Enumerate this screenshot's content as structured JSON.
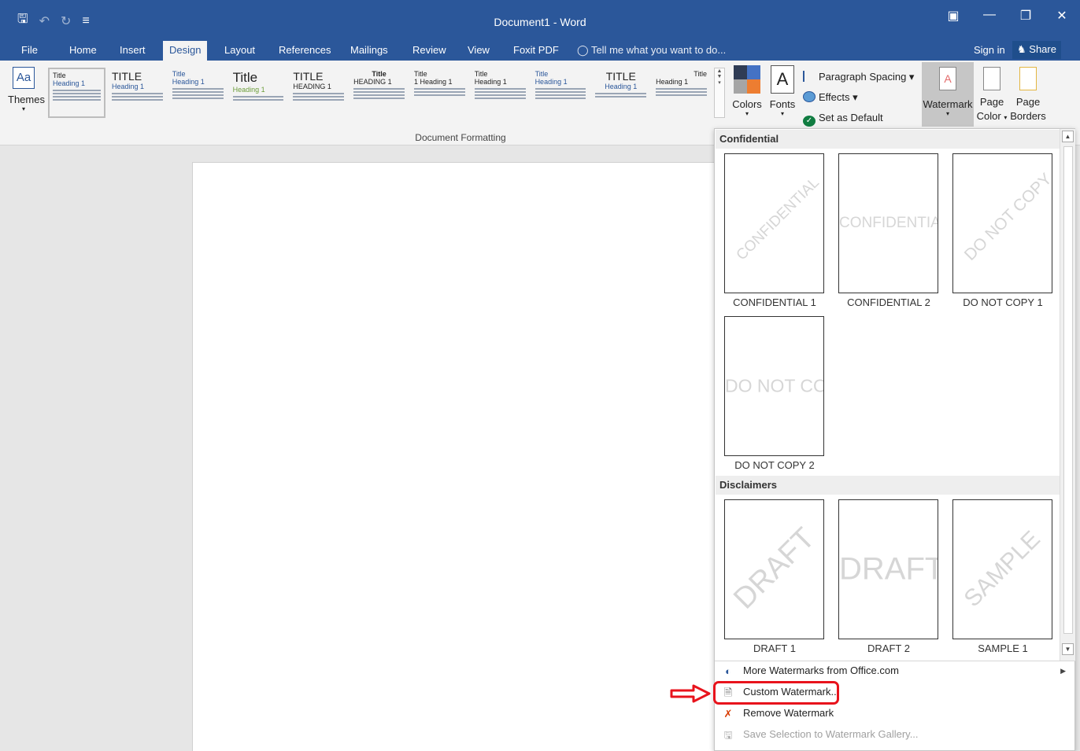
{
  "window": {
    "title": "Document1 - Word",
    "qat": {
      "save_icon": "save-icon",
      "undo_icon": "undo-icon",
      "redo_icon": "redo-icon",
      "customize_icon": "customize-qat-icon"
    },
    "controls": {
      "ribbon_options_icon": "ribbon-display-icon",
      "minimize_icon": "minimize-icon",
      "restore_icon": "restore-icon",
      "close_icon": "close-icon"
    }
  },
  "tabs": [
    "File",
    "Home",
    "Insert",
    "Design",
    "Layout",
    "References",
    "Mailings",
    "Review",
    "View",
    "Foxit PDF"
  ],
  "active_tab": "Design",
  "tell_me": "Tell me what you want to do...",
  "sign_in": "Sign in",
  "share": "Share",
  "ribbon": {
    "themes_label": "Themes",
    "themes_icon_text": "Aa",
    "style_set": [
      {
        "title": "Title",
        "heading": "Heading 1"
      },
      {
        "title": "TITLE",
        "heading": "Heading 1"
      },
      {
        "title": "Title",
        "heading": "Heading 1"
      },
      {
        "title": "Title",
        "heading": "Heading 1"
      },
      {
        "title": "TITLE",
        "heading": "HEADING 1"
      },
      {
        "title": "Title",
        "heading": "HEADING 1"
      },
      {
        "title": "Title",
        "heading": "1 Heading 1"
      },
      {
        "title": "Title",
        "heading": "Heading 1"
      },
      {
        "title": "Title",
        "heading": "Heading 1"
      },
      {
        "title": "TITLE",
        "heading": "Heading 1"
      },
      {
        "title": "Title",
        "heading": "Heading 1"
      }
    ],
    "group_label": "Document Formatting",
    "colors_label": "Colors",
    "fonts_label": "Fonts",
    "fonts_icon_text": "A",
    "paragraph_spacing": "Paragraph Spacing",
    "effects": "Effects",
    "set_as_default": "Set as Default",
    "watermark_label": "Watermark",
    "page_color_label": "Page",
    "page_color_label2": "Color",
    "page_borders_label": "Page",
    "page_borders_label2": "Borders"
  },
  "watermark_panel": {
    "sections": [
      {
        "header": "Confidential",
        "items": [
          {
            "text": "CONFIDENTIAL",
            "caption": "CONFIDENTIAL 1"
          },
          {
            "text": "CONFIDENTIAL",
            "caption": "CONFIDENTIAL 2"
          },
          {
            "text": "DO NOT COPY",
            "caption": "DO NOT COPY 1"
          },
          {
            "text": "DO NOT COPY",
            "caption": "DO NOT COPY 2"
          }
        ]
      },
      {
        "header": "Disclaimers",
        "items": [
          {
            "text": "DRAFT",
            "caption": "DRAFT 1"
          },
          {
            "text": "DRAFT",
            "caption": "DRAFT 2"
          },
          {
            "text": "SAMPLE",
            "caption": "SAMPLE 1"
          }
        ]
      }
    ],
    "menu": [
      {
        "label": "More Watermarks from Office.com",
        "icon": "office-com-icon",
        "disabled": false
      },
      {
        "label": "Custom Watermark...",
        "icon": "custom-watermark-icon",
        "disabled": false
      },
      {
        "label": "Remove Watermark",
        "icon": "remove-watermark-icon",
        "disabled": false
      },
      {
        "label": "Save Selection to Watermark Gallery...",
        "icon": "save-to-gallery-icon",
        "disabled": true
      }
    ]
  },
  "colors": {
    "brand": "#2b579a",
    "highlight": "#e8131c"
  }
}
